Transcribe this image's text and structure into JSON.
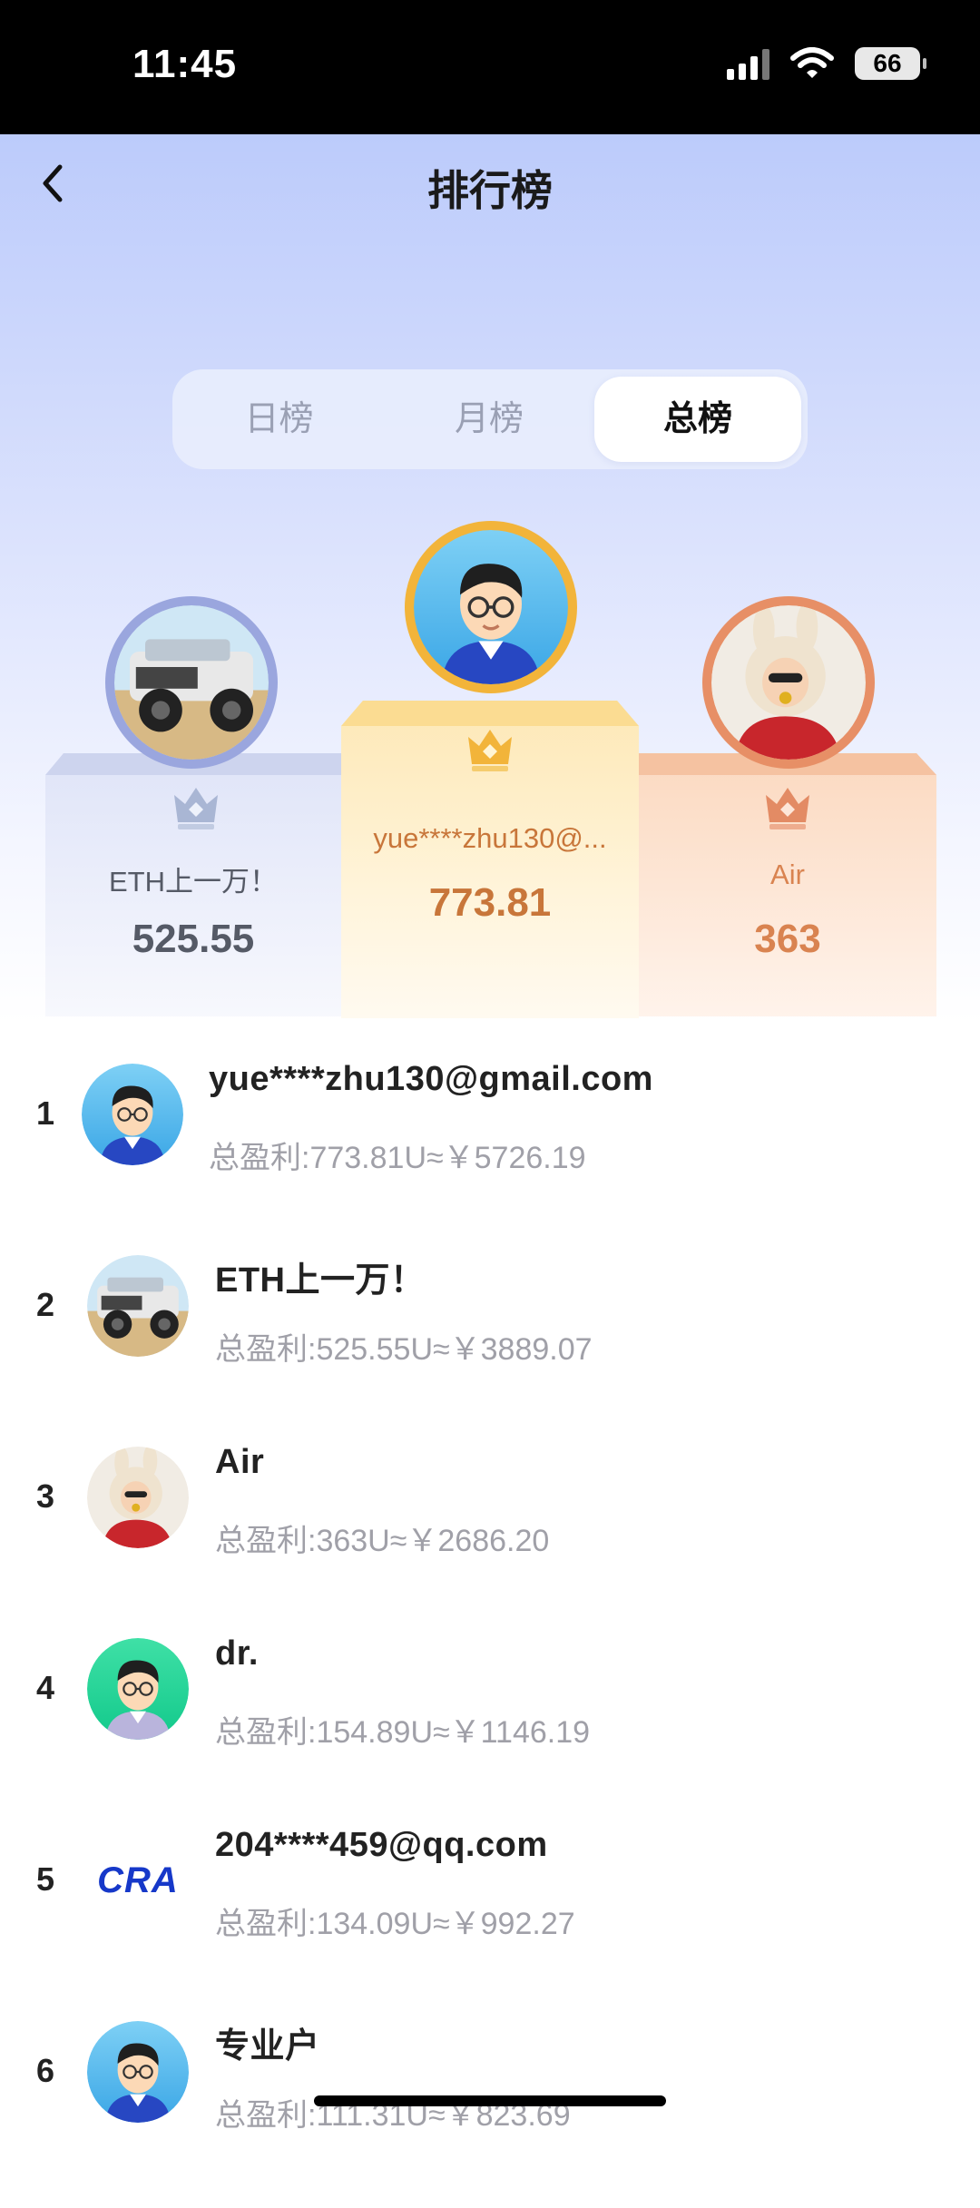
{
  "status_bar": {
    "time": "11:45",
    "battery": "66"
  },
  "header": {
    "title": "排行榜"
  },
  "tabs": [
    {
      "label": "日榜",
      "active": false
    },
    {
      "label": "月榜",
      "active": false
    },
    {
      "label": "总榜",
      "active": true
    }
  ],
  "podium": {
    "first": {
      "name": "yue****zhu130@...",
      "value": "773.81"
    },
    "second": {
      "name": "ETH上一万！",
      "value": "525.55"
    },
    "third": {
      "name": "Air",
      "value": "363"
    }
  },
  "ranking": [
    {
      "rank": "1",
      "name": "yue****zhu130@gmail.com",
      "profit": "总盈利:773.81U≈￥5726.19",
      "avatar": "cartoon-glasses-blue"
    },
    {
      "rank": "2",
      "name": "ETH上一万！",
      "profit": "总盈利:525.55U≈￥3889.07",
      "avatar": "jeep-photo"
    },
    {
      "rank": "3",
      "name": "Air",
      "profit": "总盈利:363U≈￥2686.20",
      "avatar": "bunny-hat-photo"
    },
    {
      "rank": "4",
      "name": "dr.",
      "profit": "总盈利:154.89U≈￥1146.19",
      "avatar": "cartoon-glasses-green"
    },
    {
      "rank": "5",
      "name": "204****459@qq.com",
      "profit": "总盈利:134.09U≈￥992.27",
      "avatar": "cra-logo",
      "logo_text": "CRA"
    },
    {
      "rank": "6",
      "name": "专业户",
      "profit": "总盈利:111.31U≈￥823.69",
      "avatar": "cartoon-glasses-blue"
    }
  ],
  "colors": {
    "gold": "#f2b43a",
    "silver": "#9aa6de",
    "bronze": "#e78f66",
    "gold_text": "#c8763a",
    "silver_text": "#555a66",
    "bronze_text": "#d98350",
    "cra_blue": "#1638c9",
    "cra_green": "#22b35a"
  }
}
